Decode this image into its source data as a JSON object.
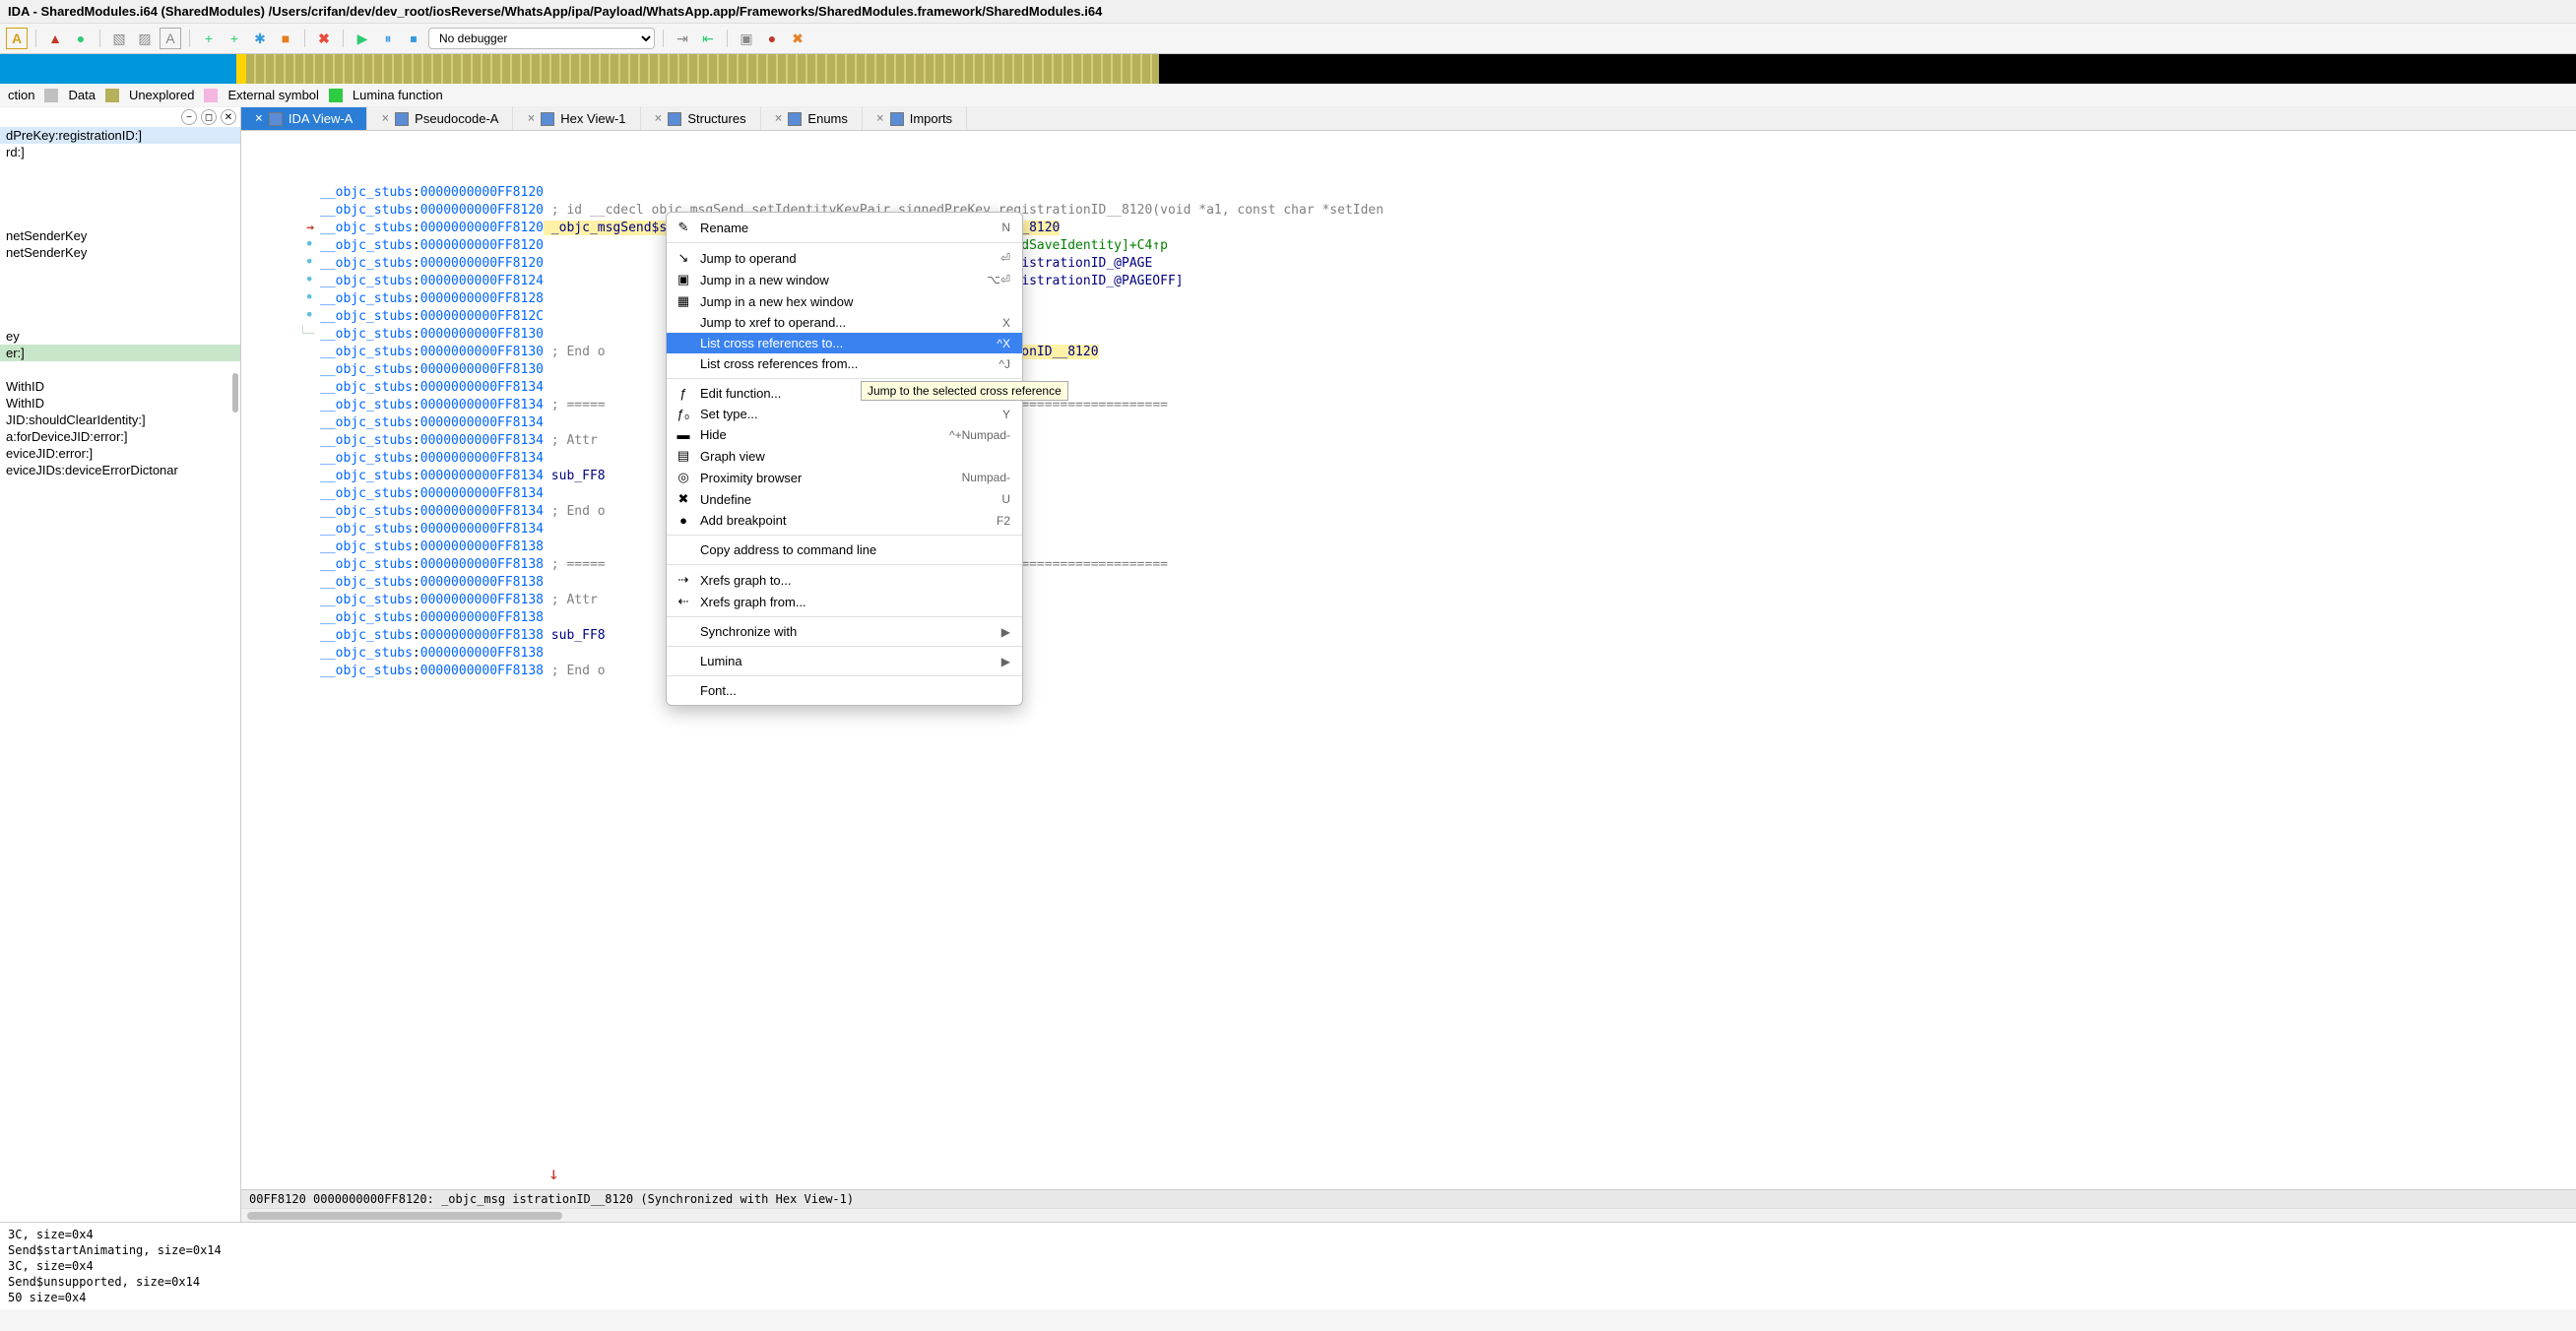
{
  "title": "IDA - SharedModules.i64 (SharedModules) /Users/crifan/dev/dev_root/iosReverse/WhatsApp/ipa/Payload/WhatsApp.app/Frameworks/SharedModules.framework/SharedModules.i64",
  "debugger_select": "No debugger",
  "legend": {
    "func": "ction",
    "data": "Data",
    "unexplored": "Unexplored",
    "extsym": "External symbol",
    "lumina": "Lumina function"
  },
  "tabs": [
    {
      "label": "IDA View-A"
    },
    {
      "label": "Pseudocode-A"
    },
    {
      "label": "Hex View-1"
    },
    {
      "label": "Structures"
    },
    {
      "label": "Enums"
    },
    {
      "label": "Imports"
    }
  ],
  "side_items": [
    {
      "text": "dPreKey:registrationID:]",
      "sel": true
    },
    {
      "text": "rd:]"
    },
    {
      "text": ""
    },
    {
      "text": ""
    },
    {
      "text": ""
    },
    {
      "text": ""
    },
    {
      "text": "netSenderKey"
    },
    {
      "text": "netSenderKey"
    },
    {
      "text": ""
    },
    {
      "text": ""
    },
    {
      "text": ""
    },
    {
      "text": ""
    },
    {
      "text": "ey"
    },
    {
      "text": "er:]",
      "hl": true
    },
    {
      "text": ""
    },
    {
      "text": "WithID"
    },
    {
      "text": "WithID"
    },
    {
      "text": "JID:shouldClearIdentity:]"
    },
    {
      "text": "a:forDeviceJID:error:]"
    },
    {
      "text": "eviceJID:error:]"
    },
    {
      "text": "eviceJIDs:deviceErrorDictonar"
    }
  ],
  "disasm": [
    {
      "g": "",
      "seg": "__objc_stubs",
      "addr": "0000000000FF8120",
      "rest": ""
    },
    {
      "g": "",
      "seg": "__objc_stubs",
      "addr": "0000000000FF8120",
      "rest": " ; id __cdecl objc_msgSend_setIdentityKeyPair_signedPreKey_registrationID__8120(void *a1, const char *setIden",
      "cls": "cmt"
    },
    {
      "g": "arr",
      "seg": "__objc_stubs",
      "addr": "0000000000FF8120",
      "rest": " _objc_msgSend$setIdentityKeyPair_signedPreKey_registrationID__8120",
      "cls": "hl-y"
    },
    {
      "g": "dot",
      "seg": "__objc_stubs",
      "addr": "0000000000FF8120",
      "tail_green": ": -[WASignalCoordinator createAndSaveIdentity]+C4↑p"
    },
    {
      "g": "dot",
      "seg": "__objc_stubs",
      "addr": "0000000000FF8120",
      "tail_navy": "IdentityKeyPair_signedPreKey_registrationID_@PAGE"
    },
    {
      "g": "dot",
      "seg": "__objc_stubs",
      "addr": "0000000000FF8124",
      "tail_navy": "IdentityKeyPair_signedPreKey_registrationID_@PAGEOFF]"
    },
    {
      "g": "dot",
      "seg": "__objc_stubs",
      "addr": "0000000000FF8128",
      "tail_navy": "_ptr@PAGE"
    },
    {
      "g": "dot",
      "seg": "__objc_stubs",
      "addr": "0000000000FF812C",
      "tail_navy": "gSend_ptr@PAGEOFF]"
    },
    {
      "g": "dashr",
      "seg": "__objc_stubs",
      "addr": "0000000000FF8130",
      "rest": ""
    },
    {
      "g": "",
      "seg": "__objc_stubs",
      "addr": "0000000000FF8130",
      "rest": " ; End o",
      "cls": "cmt",
      "tail_hl": "_signedPreKey_registrationID__8120"
    },
    {
      "g": "",
      "seg": "__objc_stubs",
      "addr": "0000000000FF8130",
      "rest": ""
    },
    {
      "g": "",
      "seg": "__objc_stubs",
      "addr": "0000000000FF8134",
      "rest": ""
    },
    {
      "g": "",
      "seg": "__objc_stubs",
      "addr": "0000000000FF8134",
      "rest": " ; =====",
      "cls": "cmt",
      "tail_cmt": "==========================================="
    },
    {
      "g": "",
      "seg": "__objc_stubs",
      "addr": "0000000000FF8134",
      "rest": ""
    },
    {
      "g": "",
      "seg": "__objc_stubs",
      "addr": "0000000000FF8134",
      "rest": " ; Attr",
      "cls": "cmt"
    },
    {
      "g": "",
      "seg": "__objc_stubs",
      "addr": "0000000000FF8134",
      "rest": ""
    },
    {
      "g": "",
      "seg": "__objc_stubs",
      "addr": "0000000000FF8134",
      "rest": " sub_FF8",
      "cls": "navy"
    },
    {
      "g": "",
      "seg": "__objc_stubs",
      "addr": "0000000000FF8134",
      "rest": ""
    },
    {
      "g": "",
      "seg": "__objc_stubs",
      "addr": "0000000000FF8134",
      "rest": " ; End o",
      "cls": "cmt"
    },
    {
      "g": "",
      "seg": "__objc_stubs",
      "addr": "0000000000FF8134",
      "rest": ""
    },
    {
      "g": "",
      "seg": "__objc_stubs",
      "addr": "0000000000FF8138",
      "rest": ""
    },
    {
      "g": "",
      "seg": "__objc_stubs",
      "addr": "0000000000FF8138",
      "rest": " ; =====",
      "cls": "cmt",
      "tail_cmt": "==========================================="
    },
    {
      "g": "",
      "seg": "__objc_stubs",
      "addr": "0000000000FF8138",
      "rest": ""
    },
    {
      "g": "",
      "seg": "__objc_stubs",
      "addr": "0000000000FF8138",
      "rest": " ; Attr",
      "cls": "cmt"
    },
    {
      "g": "",
      "seg": "__objc_stubs",
      "addr": "0000000000FF8138",
      "rest": ""
    },
    {
      "g": "",
      "seg": "__objc_stubs",
      "addr": "0000000000FF8138",
      "rest": " sub_FF8",
      "cls": "navy"
    },
    {
      "g": "",
      "seg": "__objc_stubs",
      "addr": "0000000000FF8138",
      "rest": ""
    },
    {
      "g": "",
      "seg": "__objc_stubs",
      "addr": "0000000000FF8138",
      "rest": " ; End o",
      "cls": "cmt"
    }
  ],
  "status": "00FF8120 0000000000FF8120: _objc_msg                                           istrationID__8120 (Synchronized with Hex View-1)",
  "output": [
    "3C, size=0x4",
    "Send$startAnimating, size=0x14",
    "3C, size=0x4",
    "Send$unsupported, size=0x14",
    "50  size=0x4"
  ],
  "menu": [
    {
      "icon": "✎",
      "label": "Rename",
      "sc": "N"
    },
    {
      "sep": true
    },
    {
      "icon": "↘",
      "label": "Jump to operand",
      "sc": "⏎"
    },
    {
      "icon": "▣",
      "label": "Jump in a new window",
      "sc": "⌥⏎"
    },
    {
      "icon": "▦",
      "label": "Jump in a new hex window",
      "sc": ""
    },
    {
      "icon": "",
      "label": "Jump to xref to operand...",
      "sc": "X"
    },
    {
      "icon": "",
      "label": "List cross references to...",
      "sc": "^X",
      "hl": true
    },
    {
      "icon": "",
      "label": "List cross references from...",
      "sc": "^J"
    },
    {
      "sep": true
    },
    {
      "icon": "ƒ",
      "label": "Edit function...",
      "sc": "⌥P"
    },
    {
      "icon": "ƒ₀",
      "label": "Set type...",
      "sc": "Y"
    },
    {
      "icon": "▬",
      "label": "Hide",
      "sc": "^+Numpad-"
    },
    {
      "icon": "▤",
      "label": "Graph view",
      "sc": ""
    },
    {
      "icon": "◎",
      "label": "Proximity browser",
      "sc": "Numpad-"
    },
    {
      "icon": "✖",
      "label": "Undefine",
      "sc": "U"
    },
    {
      "icon": "●",
      "label": "Add breakpoint",
      "sc": "F2"
    },
    {
      "sep": true
    },
    {
      "icon": "",
      "label": "Copy address to command line",
      "sc": ""
    },
    {
      "sep": true
    },
    {
      "icon": "⇢",
      "label": "Xrefs graph to...",
      "sc": ""
    },
    {
      "icon": "⇠",
      "label": "Xrefs graph from...",
      "sc": ""
    },
    {
      "sep": true
    },
    {
      "icon": "",
      "label": "Synchronize with",
      "sc": "▶"
    },
    {
      "sep": true
    },
    {
      "icon": "",
      "label": "Lumina",
      "sc": "▶"
    },
    {
      "sep": true
    },
    {
      "icon": "",
      "label": "Font...",
      "sc": ""
    }
  ],
  "tooltip": "Jump to the selected cross reference",
  "toolbar_icons": [
    "A",
    "▲",
    "●",
    "▧",
    "▨",
    "A",
    "+",
    "+",
    "✱",
    "■",
    "✖",
    "▶",
    "⏸",
    "⏹",
    "⇥",
    "⇤",
    "▣",
    "●",
    "✖"
  ]
}
